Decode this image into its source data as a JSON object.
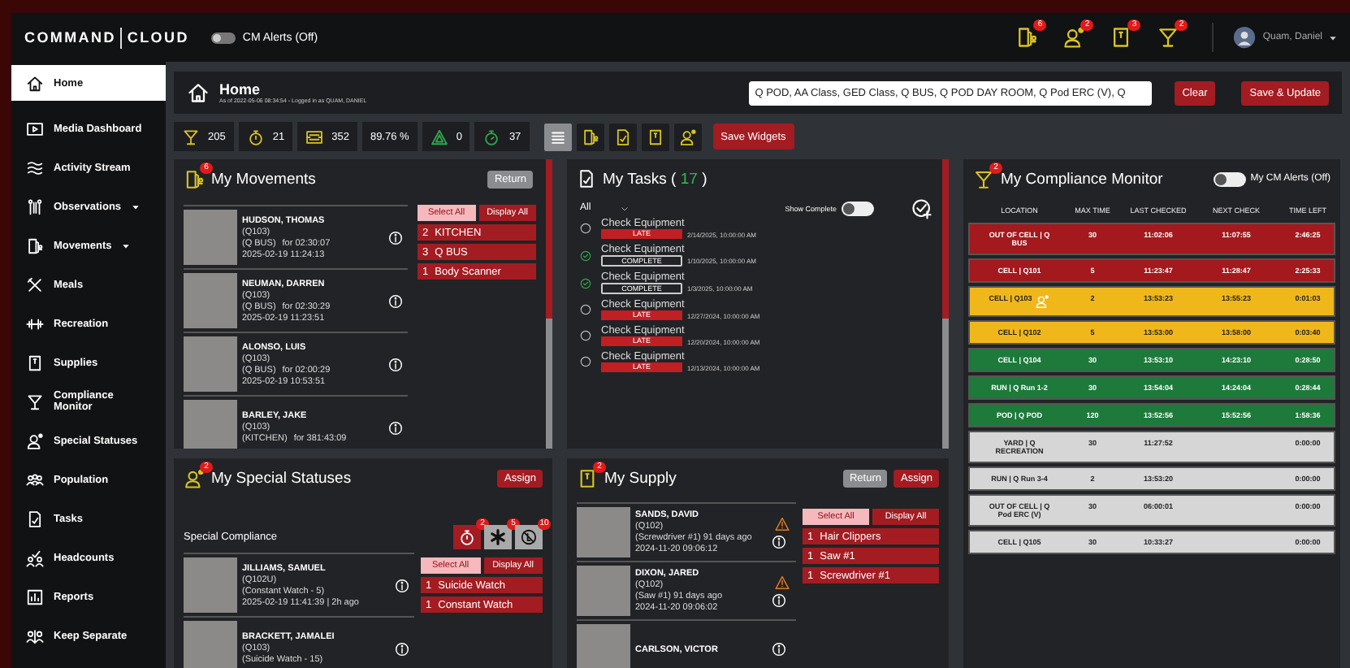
{
  "topbar": {
    "logo_left": "COMMAND",
    "logo_right": "CLOUD",
    "cm_alerts": {
      "label": "CM Alerts (Off)",
      "on": false
    },
    "notifications": [
      {
        "kind": "door",
        "badge": "6"
      },
      {
        "kind": "person-star",
        "badge": "2"
      },
      {
        "kind": "supply",
        "badge": "3"
      },
      {
        "kind": "glass",
        "badge": "2"
      }
    ],
    "user": {
      "name": "Quam, Daniel"
    }
  },
  "sidebar": {
    "items": [
      {
        "kind": "home",
        "label": "Home",
        "selected": true,
        "has_submenu": false
      },
      {
        "kind": "media",
        "label": "Media Dashboard",
        "selected": false,
        "has_submenu": false
      },
      {
        "kind": "activity",
        "label": "Activity Stream",
        "selected": false,
        "has_submenu": false
      },
      {
        "kind": "observations",
        "label": "Observations",
        "selected": false,
        "has_submenu": true
      },
      {
        "kind": "door",
        "label": "Movements",
        "selected": false,
        "has_submenu": true
      },
      {
        "kind": "meals",
        "label": "Meals",
        "selected": false,
        "has_submenu": false
      },
      {
        "kind": "dumbbell",
        "label": "Recreation",
        "selected": false,
        "has_submenu": false
      },
      {
        "kind": "supply",
        "label": "Supplies",
        "selected": false,
        "has_submenu": false
      },
      {
        "kind": "glass",
        "label": "Compliance Monitor",
        "selected": false,
        "has_submenu": false
      },
      {
        "kind": "person-star",
        "label": "Special Statuses",
        "selected": false,
        "has_submenu": false
      },
      {
        "kind": "people",
        "label": "Population",
        "selected": false,
        "has_submenu": false
      },
      {
        "kind": "doc-check",
        "label": "Tasks",
        "selected": false,
        "has_submenu": false
      },
      {
        "kind": "people-check",
        "label": "Headcounts",
        "selected": false,
        "has_submenu": false
      },
      {
        "kind": "chart",
        "label": "Reports",
        "selected": false,
        "has_submenu": false
      },
      {
        "kind": "separate",
        "label": "Keep Separate",
        "selected": false,
        "has_submenu": false
      }
    ]
  },
  "page_header": {
    "title": "Home",
    "subtitle": "As of 2022-05-06 08:34:54 - Logged in as QUAM, DANIEL",
    "search": {
      "value": "Q POD, AA Class, GED Class, Q BUS, Q POD DAY ROOM, Q Pod ERC (V), Q"
    },
    "buttons": [
      "Clear",
      "Save & Update"
    ]
  },
  "stats": [
    {
      "kind": "glass",
      "value": "205"
    },
    {
      "kind": "stopwatch",
      "value": "21"
    },
    {
      "kind": "frame",
      "value": "352"
    },
    {
      "kind": "none",
      "value": "89.76 %"
    },
    {
      "kind": "triangle",
      "value": "0"
    },
    {
      "kind": "stopwatch-green",
      "value": "37"
    }
  ],
  "widget_toggles": [
    {
      "kind": "list",
      "selected": true
    },
    {
      "kind": "door",
      "selected": false
    },
    {
      "kind": "doc-check",
      "selected": false
    },
    {
      "kind": "supply",
      "selected": false
    },
    {
      "kind": "person-star",
      "selected": false
    }
  ],
  "save_widgets": "Save Widgets",
  "movements": {
    "title": "My Movements",
    "badge": "6",
    "return": "Return",
    "select_all": "Select All",
    "display_all": "Display All",
    "people": [
      {
        "name": "HUDSON, THOMAS",
        "cell": "(Q103)",
        "location": "(Q BUS)",
        "duration": "for 02:30:07",
        "timestamp": "2025-02-19 11:24:13"
      },
      {
        "name": "NEUMAN, DARREN",
        "cell": "(Q103)",
        "location": "(Q BUS)",
        "duration": "for 02:30:29",
        "timestamp": "2025-02-19 11:23:51"
      },
      {
        "name": "ALONSO, LUIS",
        "cell": "(Q103)",
        "location": "(Q BUS)",
        "duration": "for 02:00:29",
        "timestamp": "2025-02-19 10:53:51"
      },
      {
        "name": "BARLEY, JAKE",
        "cell": "(Q103)",
        "location": "(KITCHEN)",
        "duration": "for 381:43:09"
      }
    ],
    "groups": [
      {
        "count": "2",
        "label": "KITCHEN"
      },
      {
        "count": "3",
        "label": "Q BUS"
      },
      {
        "count": "1",
        "label": "Body Scanner"
      }
    ]
  },
  "tasks": {
    "title_before": "My Tasks (",
    "count": "17",
    "title_after": ")",
    "filter": "All",
    "show_complete": {
      "label": "Show Complete",
      "on": false
    },
    "items": [
      {
        "title": "Check Equipment",
        "done": false,
        "status_label": "LATE",
        "date": "2/14/2025, 10:00:00 AM"
      },
      {
        "title": "Check Equipment",
        "done": true,
        "status_label": "COMPLETE",
        "date": "1/10/2025, 10:00:00 AM"
      },
      {
        "title": "Check Equipment",
        "done": true,
        "status_label": "COMPLETE",
        "date": "1/3/2025, 10:00:00 AM"
      },
      {
        "title": "Check Equipment",
        "done": false,
        "status_label": "LATE",
        "date": "12/27/2024, 10:00:00 AM"
      },
      {
        "title": "Check Equipment",
        "done": false,
        "status_label": "LATE",
        "date": "12/20/2024, 10:00:00 AM"
      },
      {
        "title": "Check Equipment",
        "done": false,
        "status_label": "LATE",
        "date": "12/13/2024, 10:00:00 AM"
      }
    ]
  },
  "compliance": {
    "title": "My Compliance Monitor",
    "badge": "2",
    "alerts": {
      "label": "My CM Alerts (Off)",
      "on": false
    },
    "columns": [
      "LOCATION",
      "MAX TIME",
      "LAST CHECKED",
      "NEXT CHECK",
      "TIME LEFT"
    ],
    "rows": [
      {
        "location": "OUT OF CELL | Q BUS",
        "max_time": "30",
        "last_checked": "11:02:06",
        "next_check": "11:07:55",
        "time_left": "2:46:25",
        "color": "#a3191e",
        "flagged": false
      },
      {
        "location": "CELL | Q101",
        "max_time": "5",
        "last_checked": "11:23:47",
        "next_check": "11:28:47",
        "time_left": "2:25:33",
        "color": "#a3191e",
        "flagged": false
      },
      {
        "location": "CELL | Q103",
        "max_time": "2",
        "last_checked": "13:53:23",
        "next_check": "13:55:23",
        "time_left": "0:01:03",
        "color": "#f0b71b",
        "flagged": true
      },
      {
        "location": "CELL | Q102",
        "max_time": "5",
        "last_checked": "13:53:00",
        "next_check": "13:58:00",
        "time_left": "0:03:40",
        "color": "#f0b71b",
        "flagged": false
      },
      {
        "location": "CELL | Q104",
        "max_time": "30",
        "last_checked": "13:53:10",
        "next_check": "14:23:10",
        "time_left": "0:28:50",
        "color": "#1d7a3b",
        "flagged": false
      },
      {
        "location": "RUN | Q Run 1-2",
        "max_time": "30",
        "last_checked": "13:54:04",
        "next_check": "14:24:04",
        "time_left": "0:28:44",
        "color": "#1d7a3b",
        "flagged": false
      },
      {
        "location": "POD | Q POD",
        "max_time": "120",
        "last_checked": "13:52:56",
        "next_check": "15:52:56",
        "time_left": "1:58:36",
        "color": "#1d7a3b",
        "flagged": false
      },
      {
        "location": "YARD | Q RECREATION",
        "max_time": "30",
        "last_checked": "11:27:52",
        "time_left": "0:00:00",
        "color": "#d6d6d6",
        "flagged": false
      },
      {
        "location": "RUN | Q Run 3-4",
        "max_time": "2",
        "last_checked": "13:53:20",
        "time_left": "0:00:00",
        "color": "#d6d6d6",
        "flagged": false
      },
      {
        "location": "OUT OF CELL | Q Pod ERC (V)",
        "max_time": "30",
        "last_checked": "06:00:01",
        "time_left": "0:00:00",
        "color": "#d6d6d6",
        "flagged": false
      },
      {
        "location": "CELL | Q105",
        "max_time": "30",
        "last_checked": "10:33:27",
        "time_left": "0:00:00",
        "color": "#d6d6d6",
        "flagged": false
      }
    ]
  },
  "special_statuses": {
    "title": "My Special Statuses",
    "badge": "2",
    "assign": "Assign",
    "section": "Special Compliance",
    "select_all": "Select All",
    "display_all": "Display All",
    "filters": [
      {
        "kind": "stopwatch",
        "badge": "2",
        "selected": true
      },
      {
        "kind": "asterisk",
        "badge": "5",
        "selected": false
      },
      {
        "kind": "no-symbol",
        "badge": "10",
        "selected": false
      }
    ],
    "people": [
      {
        "name": "JILLIAMS, SAMUEL",
        "cell": "(Q102U)",
        "status": "(Constant Watch - 5)",
        "timestamp": "2025-02-19 11:41:39 | 2h ago"
      },
      {
        "name": "BRACKETT, JAMALEI",
        "cell": "(Q103)",
        "status": "(Suicide Watch - 15)"
      }
    ],
    "groups": [
      {
        "count": "1",
        "label": "Suicide Watch"
      },
      {
        "count": "1",
        "label": "Constant Watch"
      }
    ]
  },
  "supply": {
    "title": "My Supply",
    "badge": "2",
    "return": "Return",
    "assign": "Assign",
    "select_all": "Select All",
    "display_all": "Display All",
    "people": [
      {
        "name": "SANDS, DAVID",
        "cell": "(Q102)",
        "item_age": "(Screwdriver #1) 91 days ago",
        "timestamp": "2024-11-20 09:06:12",
        "warning": true
      },
      {
        "name": "DIXON, JARED",
        "cell": "(Q102)",
        "item_age": "(Saw #1) 91 days ago",
        "timestamp": "2024-11-20 09:06:02",
        "warning": true
      },
      {
        "name": "CARLSON, VICTOR",
        "warning": false
      }
    ],
    "groups": [
      {
        "count": "1",
        "label": "Hair Clippers"
      },
      {
        "count": "1",
        "label": "Saw #1"
      },
      {
        "count": "1",
        "label": "Screwdriver #1"
      }
    ]
  }
}
